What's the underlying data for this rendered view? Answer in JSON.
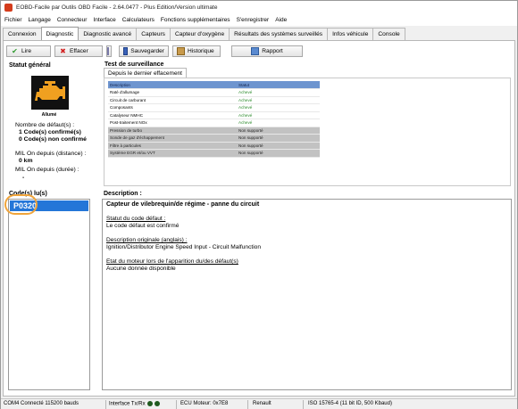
{
  "window": {
    "title": "EOBD-Facile par Outils OBD Facile - 2.64.0477 - Plus Edition/Version ultimate"
  },
  "menu": [
    "Fichier",
    "Langage",
    "Connecteur",
    "Interface",
    "Calculateurs",
    "Fonctions supplémentaires",
    "S'enregistrer",
    "Aide"
  ],
  "tabs": [
    "Connexion",
    "Diagnostic",
    "Diagnostic avancé",
    "Capteurs",
    "Capteur d'oxygène",
    "Résultats des systèmes surveillés",
    "Infos véhicule",
    "Console"
  ],
  "active_tab": "Diagnostic",
  "toolbar": {
    "read_label": "Lire",
    "erase_label": "Effacer",
    "save_label": "Sauvegarder",
    "history_label": "Historique",
    "report_label": "Rapport"
  },
  "status": {
    "title": "Statut général",
    "mil_caption": "Allumé",
    "fault_count_label": "Nombre de défaut(s) :",
    "confirmed": "1 Code(s) confirmé(s)",
    "unconfirmed": "0 Code(s) non confirmé",
    "mil_distance_label": "MIL On depuis (distance) :",
    "mil_distance_value": "0 km",
    "mil_duration_label": "MIL On depuis (durée) :",
    "mil_duration_value": "-"
  },
  "monitor": {
    "title": "Test de surveillance",
    "subtab": "Depuis le dernier effacement",
    "col_description": "Description",
    "col_status": "Statut",
    "rows": [
      {
        "description": "Raté d'allumage",
        "status": "Achevé",
        "grey": false
      },
      {
        "description": "Circuit de carburant",
        "status": "Achevé",
        "grey": false
      },
      {
        "description": "Composants",
        "status": "Achevé",
        "grey": false
      },
      {
        "description": "Catalyseur NMHC",
        "status": "Achevé",
        "grey": false
      },
      {
        "description": "Post-traitement NOx",
        "status": "Achevé",
        "grey": false
      },
      {
        "description": "Pression de turbo",
        "status": "Non supporté",
        "grey": true
      },
      {
        "description": "Sonde de gaz d'échappement",
        "status": "Non supporté",
        "grey": true
      },
      {
        "description": "Filtre à particules",
        "status": "Non supporté",
        "grey": true
      },
      {
        "description": "Système EGR et/ou VVT",
        "status": "Non supporté",
        "grey": true
      }
    ]
  },
  "codes": {
    "title": "Code(s) lu(s)",
    "items": [
      "P0320"
    ]
  },
  "description": {
    "title": "Description :",
    "heading": "Capteur de vilebrequin/de régime - panne du circuit",
    "status_label": "Statut du code défaut :",
    "status_value": "Le code défaut est confirmé",
    "orig_label": "Description originale (anglais) :",
    "orig_value": "Ignition/Distributor Engine Speed Input - Circuit Malfunction",
    "engine_label": "Etat du moteur lors de l'apparition du/des défaut(s)",
    "engine_value": "Aucune donnée disponible"
  },
  "statusbar": {
    "port": "COM4 Connecté 115200 bauds",
    "interface": "Interface Tx/Rx",
    "ecu": "ECU Moteur: 0x7E8",
    "brand": "Renault",
    "protocol": "ISO 15765-4 (11 bit ID, 500 Kbaud)"
  },
  "colors": {
    "selection": "#2476d8",
    "highlight_ring": "#f0a43a",
    "header_blue": "#6e95cf",
    "status_ok": "#2a8a2a",
    "mil_icon": "#f0a020"
  }
}
